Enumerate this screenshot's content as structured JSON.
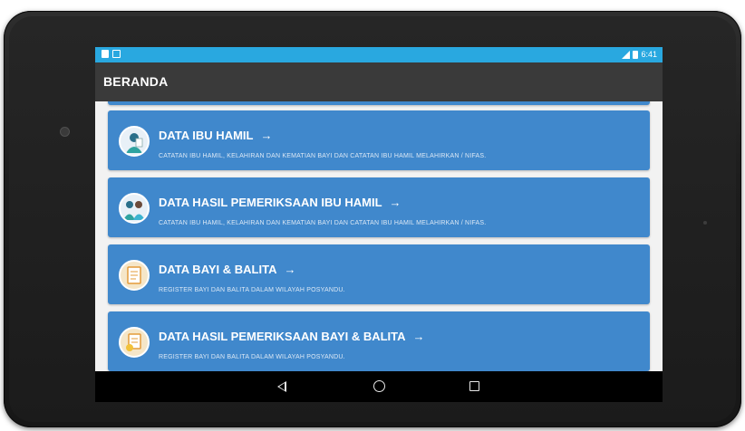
{
  "status_bar": {
    "time": "6:41",
    "left_icons": [
      "notification-icon",
      "notification-icon-2"
    ],
    "right_icons": [
      "signal-icon",
      "battery-icon"
    ]
  },
  "app_bar": {
    "title": "BERANDA"
  },
  "cards": [
    {
      "title": "DATA IBU HAMIL",
      "arrow": "→",
      "description": "CATATAN IBU HAMIL, KELAHIRAN DAN KEMATIAN BAYI DAN CATATAN IBU HAMIL MELAHIRKAN / NIFAS.",
      "icon": "pregnant-mother-icon"
    },
    {
      "title": "DATA HASIL PEMERIKSAAN IBU HAMIL",
      "arrow": "→",
      "description": "CATATAN IBU HAMIL, KELAHIRAN DAN KEMATIAN BAYI DAN CATATAN IBU HAMIL MELAHIRKAN / NIFAS.",
      "icon": "mother-checkup-icon"
    },
    {
      "title": "DATA BAYI & BALITA",
      "arrow": "→",
      "description": "REGISTER BAYI DAN BALITA DALAM WILAYAH POSYANDU.",
      "icon": "baby-register-icon"
    },
    {
      "title": "DATA HASIL PEMERIKSAAN BAYI & BALITA",
      "arrow": "→",
      "description": "REGISTER BAYI DAN BALITA DALAM WILAYAH POSYANDU.",
      "icon": "baby-checkup-icon"
    }
  ],
  "nav_bar": {
    "buttons": [
      "back-icon",
      "home-icon",
      "recent-apps-icon"
    ]
  },
  "colors": {
    "status_bar": "#29a8e0",
    "app_bar": "#3a3a3a",
    "card": "#4088cc"
  }
}
